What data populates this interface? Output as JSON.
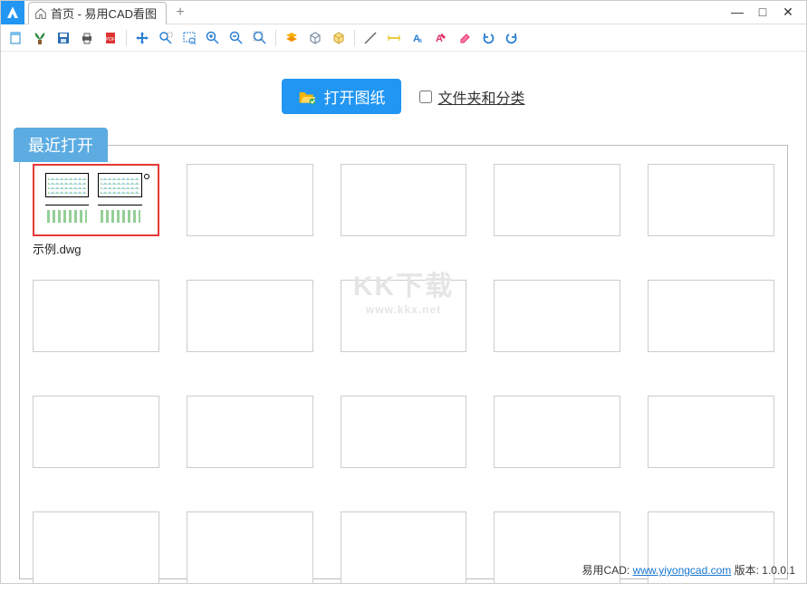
{
  "title": "首页 - 易用CAD看图",
  "tab_add": "+",
  "window": {
    "min": "—",
    "max": "□",
    "close": "✕"
  },
  "actions": {
    "open_label": "打开图纸",
    "folder_label": "文件夹和分类"
  },
  "recent_tab": "最近打开",
  "files": [
    {
      "name": "示例.dwg",
      "has_preview": true
    },
    {
      "name": ""
    },
    {
      "name": ""
    },
    {
      "name": ""
    },
    {
      "name": ""
    },
    {
      "name": ""
    },
    {
      "name": ""
    },
    {
      "name": ""
    },
    {
      "name": ""
    },
    {
      "name": ""
    },
    {
      "name": ""
    },
    {
      "name": ""
    },
    {
      "name": ""
    },
    {
      "name": ""
    },
    {
      "name": ""
    },
    {
      "name": ""
    },
    {
      "name": ""
    },
    {
      "name": ""
    },
    {
      "name": ""
    },
    {
      "name": ""
    }
  ],
  "watermark": {
    "big": "KK下载",
    "small": "www.kkx.net"
  },
  "footer": {
    "prefix": "易用CAD: ",
    "url": "www.yiyongcad.com",
    "version_label": " 版本: ",
    "version": "1.0.0.1"
  },
  "toolbar_icons": [
    "new-icon",
    "palm-icon",
    "save-icon",
    "print-icon",
    "pdf-icon",
    "pan-icon",
    "zoom-select-icon",
    "zoom-window-icon",
    "zoom-in-icon",
    "zoom-out-icon",
    "zoom-extents-icon",
    "layers-icon",
    "block-icon",
    "cube-icon",
    "line-icon",
    "dimension-icon",
    "text-icon",
    "annotate-icon",
    "erase-icon",
    "undo-icon",
    "redo-icon"
  ]
}
